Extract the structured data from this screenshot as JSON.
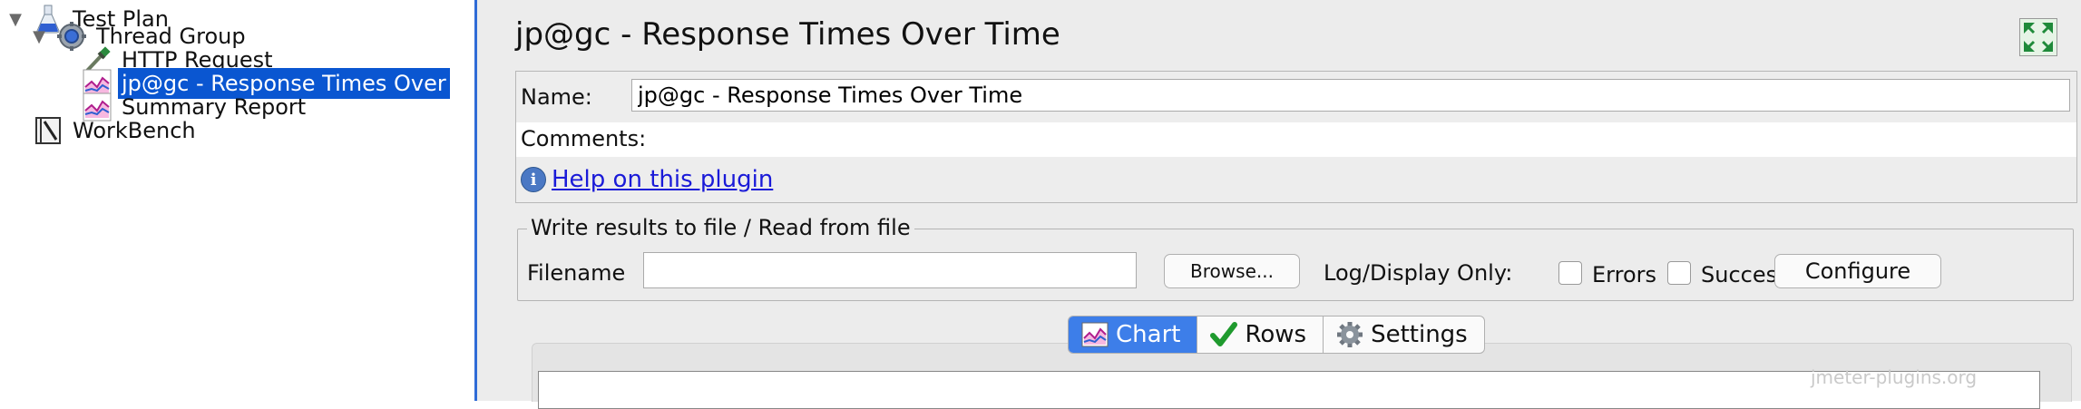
{
  "tree": {
    "items": [
      {
        "label": "Test Plan",
        "icon": "flask-icon",
        "expanded": true
      },
      {
        "label": "Thread Group",
        "icon": "gear-icon",
        "expanded": true
      },
      {
        "label": "HTTP Request",
        "icon": "pipette-icon"
      },
      {
        "label": "jp@gc - Response Times Over",
        "icon": "graph-icon",
        "selected": true
      },
      {
        "label": "Summary Report",
        "icon": "graph-icon"
      },
      {
        "label": "WorkBench",
        "icon": "workbench-icon"
      }
    ]
  },
  "panel": {
    "title": "jp@gc - Response Times Over Time",
    "name_label": "Name:",
    "name_value": "jp@gc - Response Times Over Time",
    "comments_label": "Comments:",
    "help_link": "Help on this plugin",
    "file_group": {
      "title": "Write results to file / Read from file",
      "filename_label": "Filename",
      "filename_value": "",
      "browse_label": "Browse...",
      "log_display_label": "Log/Display Only:",
      "errors_label": "Errors",
      "successes_label": "Successes",
      "configure_label": "Configure"
    },
    "tabs": [
      {
        "label": "Chart",
        "icon": "chart-icon",
        "active": true
      },
      {
        "label": "Rows",
        "icon": "checkmark-icon"
      },
      {
        "label": "Settings",
        "icon": "gear-icon"
      }
    ],
    "watermark": "jmeter-plugins.org"
  },
  "colors": {
    "selection": "#0a56d1",
    "active_tab": "#3d7ee9",
    "link": "#1a1ad8",
    "panel_bg": "#ececec"
  }
}
